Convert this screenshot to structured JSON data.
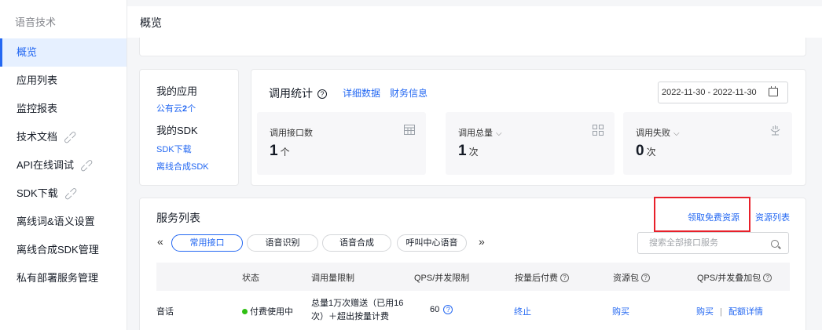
{
  "sidebar": {
    "title": "语音技术",
    "items": [
      {
        "label": "概览"
      },
      {
        "label": "应用列表"
      },
      {
        "label": "监控报表"
      },
      {
        "label": "技术文档"
      },
      {
        "label": "API在线调试"
      },
      {
        "label": "SDK下载"
      },
      {
        "label": "离线词&语义设置"
      },
      {
        "label": "离线合成SDK管理"
      },
      {
        "label": "私有部署服务管理"
      }
    ]
  },
  "header": {
    "title": "概览"
  },
  "app_card": {
    "my_apps": "我的应用",
    "public_cloud_prefix": "公有云",
    "public_cloud_count": "2",
    "public_cloud_suffix": "个",
    "my_sdk": "我的SDK",
    "sdk_download": "SDK下载",
    "offline_sdk": "离线合成SDK"
  },
  "stats": {
    "title": "调用统计",
    "detail_link": "详细数据",
    "finance_link": "财务信息",
    "date_range": "2022-11-30 - 2022-11-30",
    "metrics": [
      {
        "label": "调用接口数",
        "value": "1",
        "unit": "个",
        "icon": "table-icon"
      },
      {
        "label": "调用总量",
        "value": "1",
        "unit": "次",
        "icon": "grid-icon"
      },
      {
        "label": "调用失败",
        "value": "0",
        "unit": "次",
        "icon": "spa-icon"
      }
    ]
  },
  "services": {
    "title": "服务列表",
    "free_resource": "领取免费资源",
    "resource_list": "资源列表",
    "tabs": [
      "常用接口",
      "语音识别",
      "语音合成",
      "呼叫中心语音"
    ],
    "active_tab": "常用接口",
    "search_placeholder": "搜索全部接口服务",
    "columns": [
      "状态",
      "调用量限制",
      "QPS/并发限制",
      "按量后付费",
      "资源包",
      "QPS/并发叠加包"
    ],
    "rows": [
      {
        "name": "音话",
        "status": "付费使用中",
        "limit_line1": "总量1万次赠送（已用16",
        "limit_line2": "次）＋超出按量计费",
        "qps": "60",
        "postpay": "终止",
        "package": "购买",
        "addon_buy": "购买",
        "addon_separator": "|",
        "addon_detail": "配额详情"
      }
    ]
  },
  "colors": {
    "accent": "#2468f2",
    "highlight": "#e8202a",
    "status_ok": "#30bf13"
  }
}
